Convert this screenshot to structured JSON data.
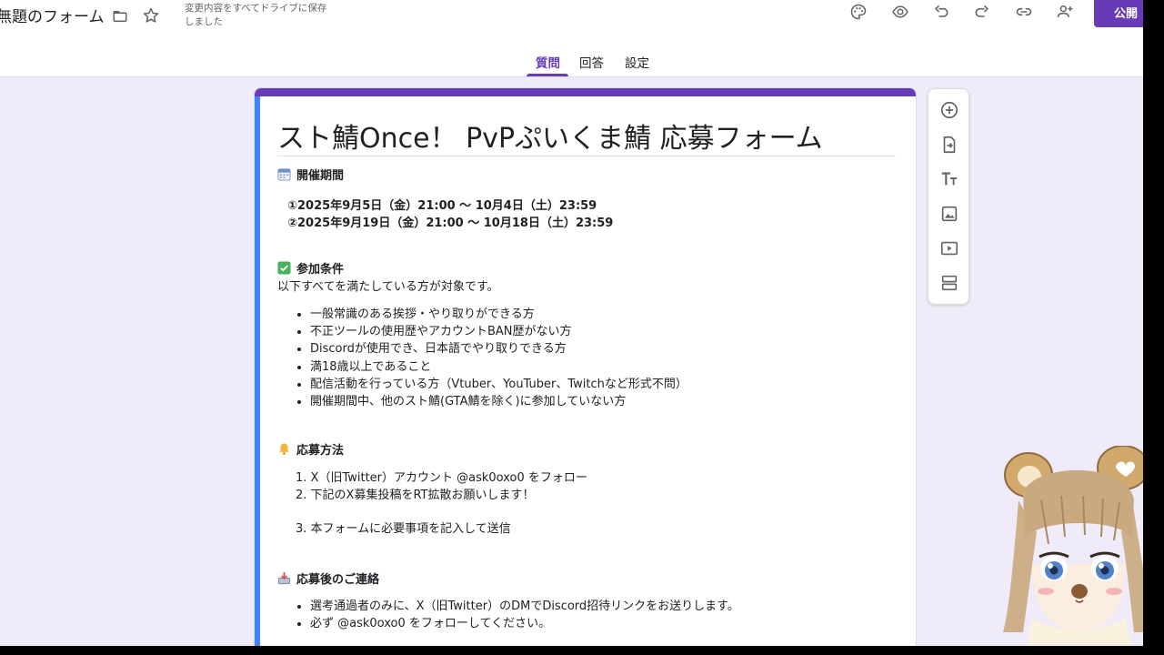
{
  "header": {
    "form_title": "無題のフォーム",
    "save_status": "変更内容をすべてドライブに保存しました",
    "publish_label": "公開",
    "icons": [
      "folder-icon",
      "star-icon",
      "palette-icon",
      "eye-icon",
      "undo-icon",
      "redo-icon",
      "link-icon",
      "add-person-icon"
    ]
  },
  "tabs": [
    {
      "label": "質問",
      "active": true
    },
    {
      "label": "回答",
      "active": false
    },
    {
      "label": "設定",
      "active": false
    }
  ],
  "form": {
    "title": "スト鯖Once！ PvPぷいくま鯖 応募フォーム",
    "sections": {
      "period": {
        "heading": "開催期間",
        "lines": [
          "①2025年9月5日（金）21:00 〜 10月4日（土）23:59",
          "②2025年9月19日（金）21:00 〜 10月18日（土）23:59"
        ]
      },
      "conditions": {
        "heading": "参加条件",
        "intro": "以下すべてを満たしている方が対象です。",
        "items": [
          "一般常識のある挨拶・やり取りができる方",
          "不正ツールの使用歴やアカウントBAN歴がない方",
          "Discordが使用でき、日本語でやり取りできる方",
          "満18歳以上であること",
          "配信活動を行っている方（Vtuber、YouTuber、Twitchなど形式不問）",
          "開催期間中、他のスト鯖(GTA鯖を除く)に参加していない方"
        ]
      },
      "apply": {
        "heading": "応募方法",
        "steps": [
          "1. X（旧Twitter）アカウント @ask0oxo0 をフォロー",
          "2. 下記のX募集投稿をRT拡散お願いします！",
          "3. 本フォームに必要事項を記入して送信"
        ]
      },
      "after": {
        "heading": "応募後のご連絡",
        "items": [
          "選考通過者のみに、X（旧Twitter）のDMでDiscord招待リンクをお送りします。",
          "必ず @ask0oxo0 をフォローしてください。"
        ]
      }
    }
  },
  "side_toolbar": [
    "add-question-icon",
    "import-icon",
    "title-text-icon",
    "image-icon",
    "video-icon",
    "section-icon"
  ],
  "colors": {
    "accent": "#673ab7",
    "background": "#f0ebf8",
    "card_left_bar": "#4285f4"
  }
}
